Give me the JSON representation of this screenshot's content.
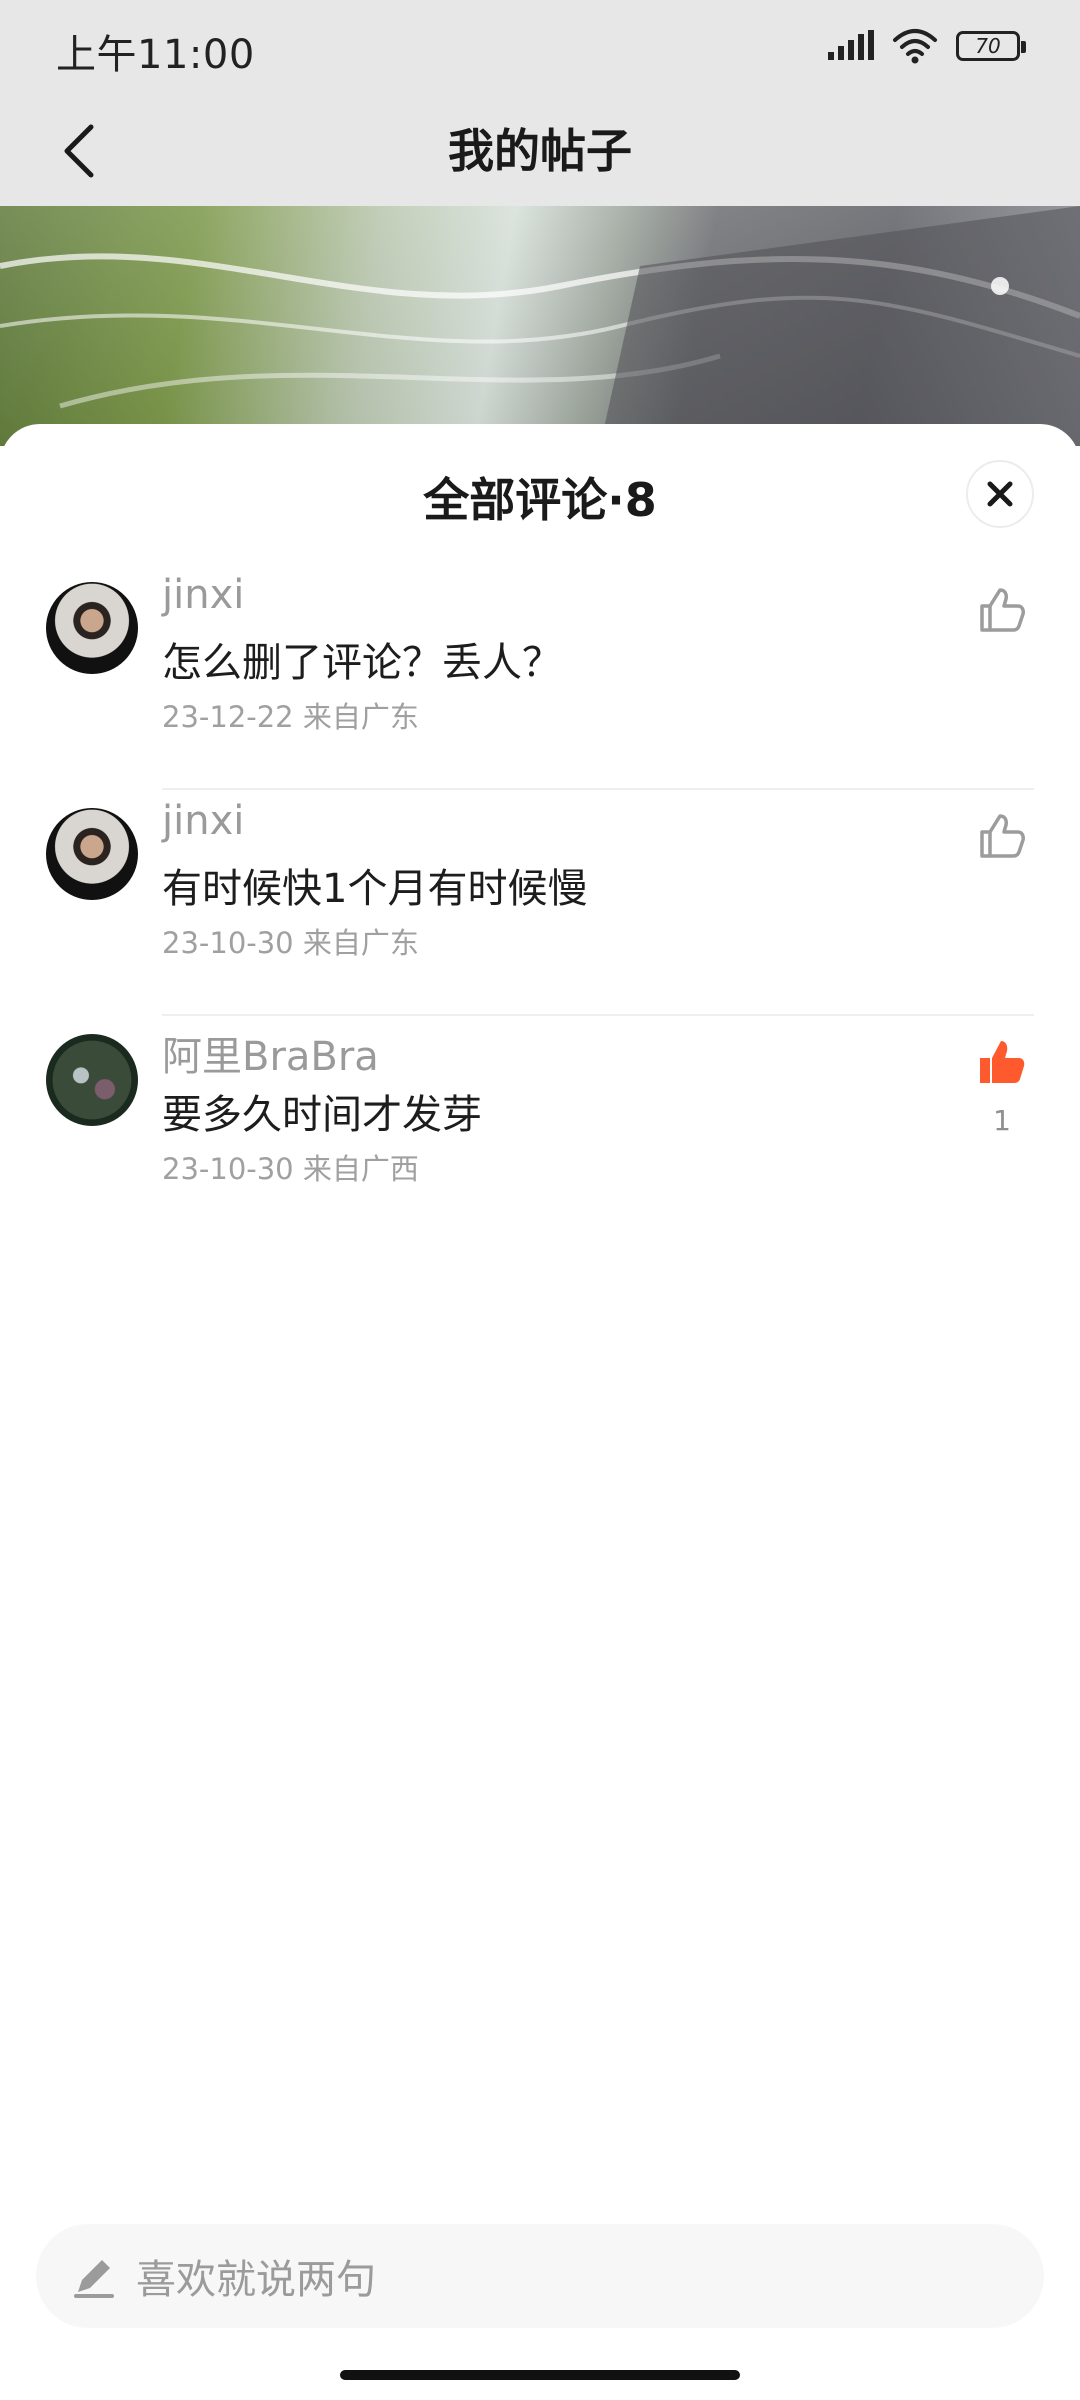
{
  "status_bar": {
    "time": "上午11:00",
    "battery": "70"
  },
  "header": {
    "title": "我的帖子"
  },
  "sheet": {
    "title": "全部评论·8"
  },
  "comments": [
    {
      "username": "jinxi",
      "text": "怎么删了评论？丢人？",
      "meta": "23-12-22 来自广东",
      "liked": false,
      "like_count": ""
    },
    {
      "username": "jinxi",
      "text": "有时候快1个月有时候慢",
      "meta": "23-10-30 来自广东",
      "liked": false,
      "like_count": ""
    },
    {
      "username": "阿里BraBra",
      "text": "要多久时间才发芽",
      "meta": "23-10-30 来自广西",
      "liked": true,
      "like_count": "1"
    }
  ],
  "input": {
    "placeholder": "喜欢就说两句"
  },
  "colors": {
    "like_active": "#ff5a2e",
    "like_inactive": "#9c9c9c"
  },
  "icons": [
    "back-arrow-icon",
    "signal-icon",
    "wifi-icon",
    "battery-icon",
    "close-icon",
    "thumbs-up-icon",
    "pen-icon"
  ]
}
